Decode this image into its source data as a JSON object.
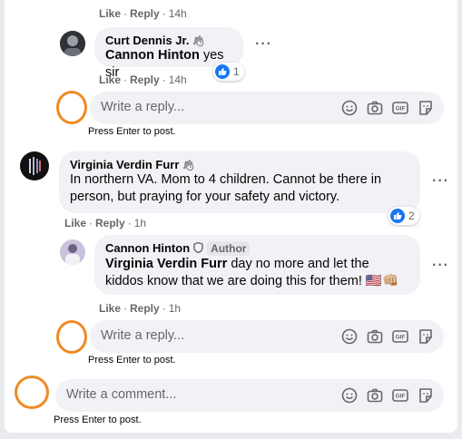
{
  "labels": {
    "like": "Like",
    "reply": "Reply",
    "dot": "·",
    "more": "···",
    "press_enter": "Press Enter to post."
  },
  "top_row": {
    "time": "14h"
  },
  "comments": [
    {
      "author": "Curt Dennis Jr.",
      "mention": "Cannon Hinton",
      "text": "yes sir",
      "time": "14h",
      "reactions": "1",
      "reply_placeholder": "Write a reply..."
    },
    {
      "author": "Virginia Verdin Furr",
      "text": "In northern VA. Mom to 4 children. Cannot be there in person, but praying for your safety and victory.",
      "time": "1h",
      "reactions": "2"
    },
    {
      "author": "Cannon Hinton",
      "badge": "Author",
      "mention": "Virginia Verdin Furr",
      "text": "day no more and let the kiddos know that we are doing this for them! 🇺🇸👊🏼",
      "time": "1h",
      "reply_placeholder": "Write a reply..."
    }
  ],
  "comment_box": {
    "placeholder": "Write a comment..."
  },
  "icons": [
    "emoji-icon",
    "camera-icon",
    "gif-icon",
    "sticker-icon",
    "like-reaction-icon",
    "more-icon",
    "wave-icon",
    "author-shield-icon"
  ],
  "colors": {
    "highlight_circle": "#f08a24",
    "like_blue": "#1877f2",
    "secondary_text": "#65676b",
    "input_bg": "#f0f2f5"
  }
}
